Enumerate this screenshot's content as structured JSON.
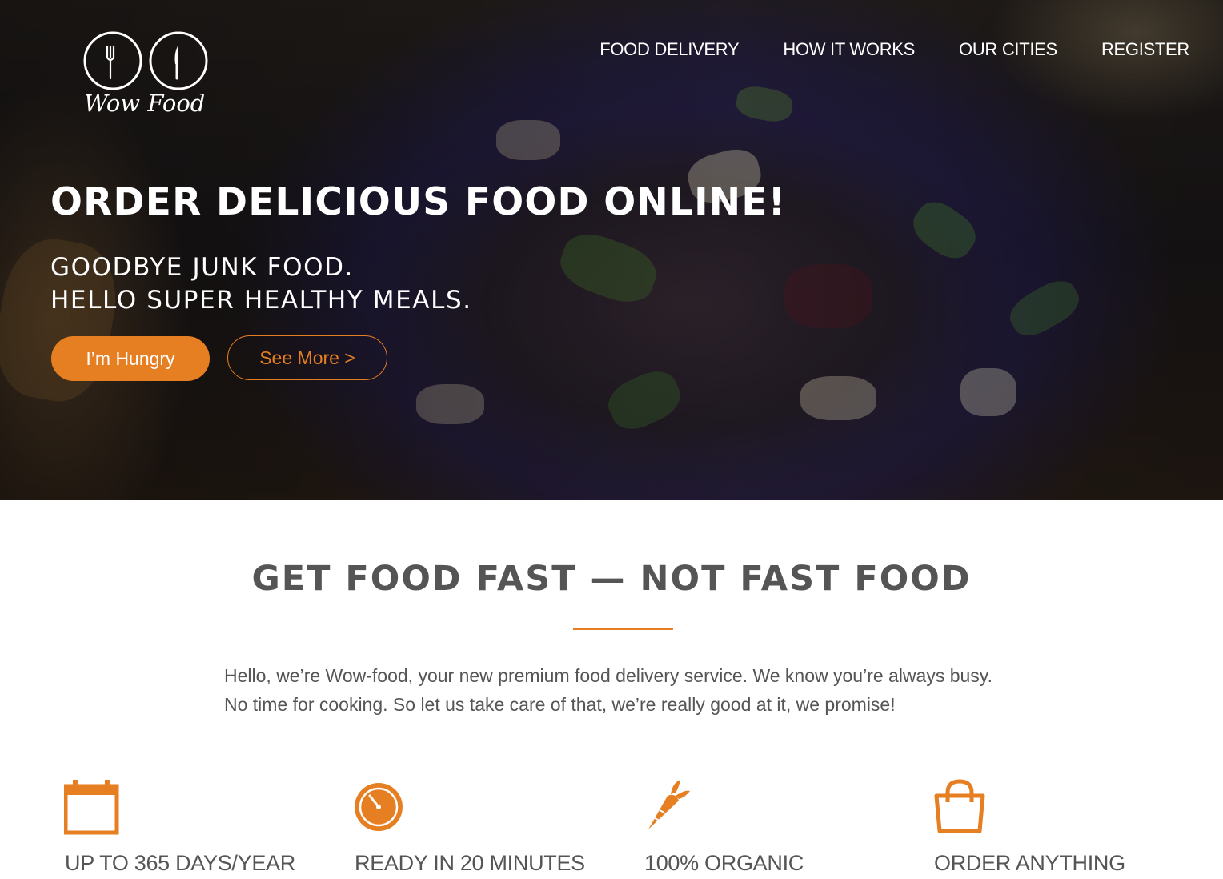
{
  "brand": {
    "name": "Wow Food",
    "accent_color": "#e67e22",
    "logo_icons": [
      "fork-icon",
      "knife-icon"
    ]
  },
  "nav": {
    "items": [
      {
        "label": "FOOD DELIVERY"
      },
      {
        "label": "HOW IT WORKS"
      },
      {
        "label": "OUR CITIES"
      },
      {
        "label": "REGISTER"
      }
    ]
  },
  "hero": {
    "title": "ORDER DELICIOUS FOOD ONLINE!",
    "subtitle_line1": "GOODBYE JUNK FOOD.",
    "subtitle_line2": "HELLO SUPER HEALTHY MEALS.",
    "primary_button": "I’m Hungry",
    "secondary_button": "See More >"
  },
  "section": {
    "title": "GET FOOD FAST — NOT FAST FOOD",
    "intro": "Hello, we’re Wow-food, your new premium food delivery service. We know you’re always busy. No time for cooking. So let us take care of that, we’re really good at it, we promise!"
  },
  "features": [
    {
      "icon": "calendar-icon",
      "label": "UP TO 365 DAYS/YEAR"
    },
    {
      "icon": "stopwatch-icon",
      "label": "READY IN 20 MINUTES"
    },
    {
      "icon": "carrot-icon",
      "label": "100% ORGANIC"
    },
    {
      "icon": "shopping-bag-icon",
      "label": "ORDER ANYTHING"
    }
  ]
}
